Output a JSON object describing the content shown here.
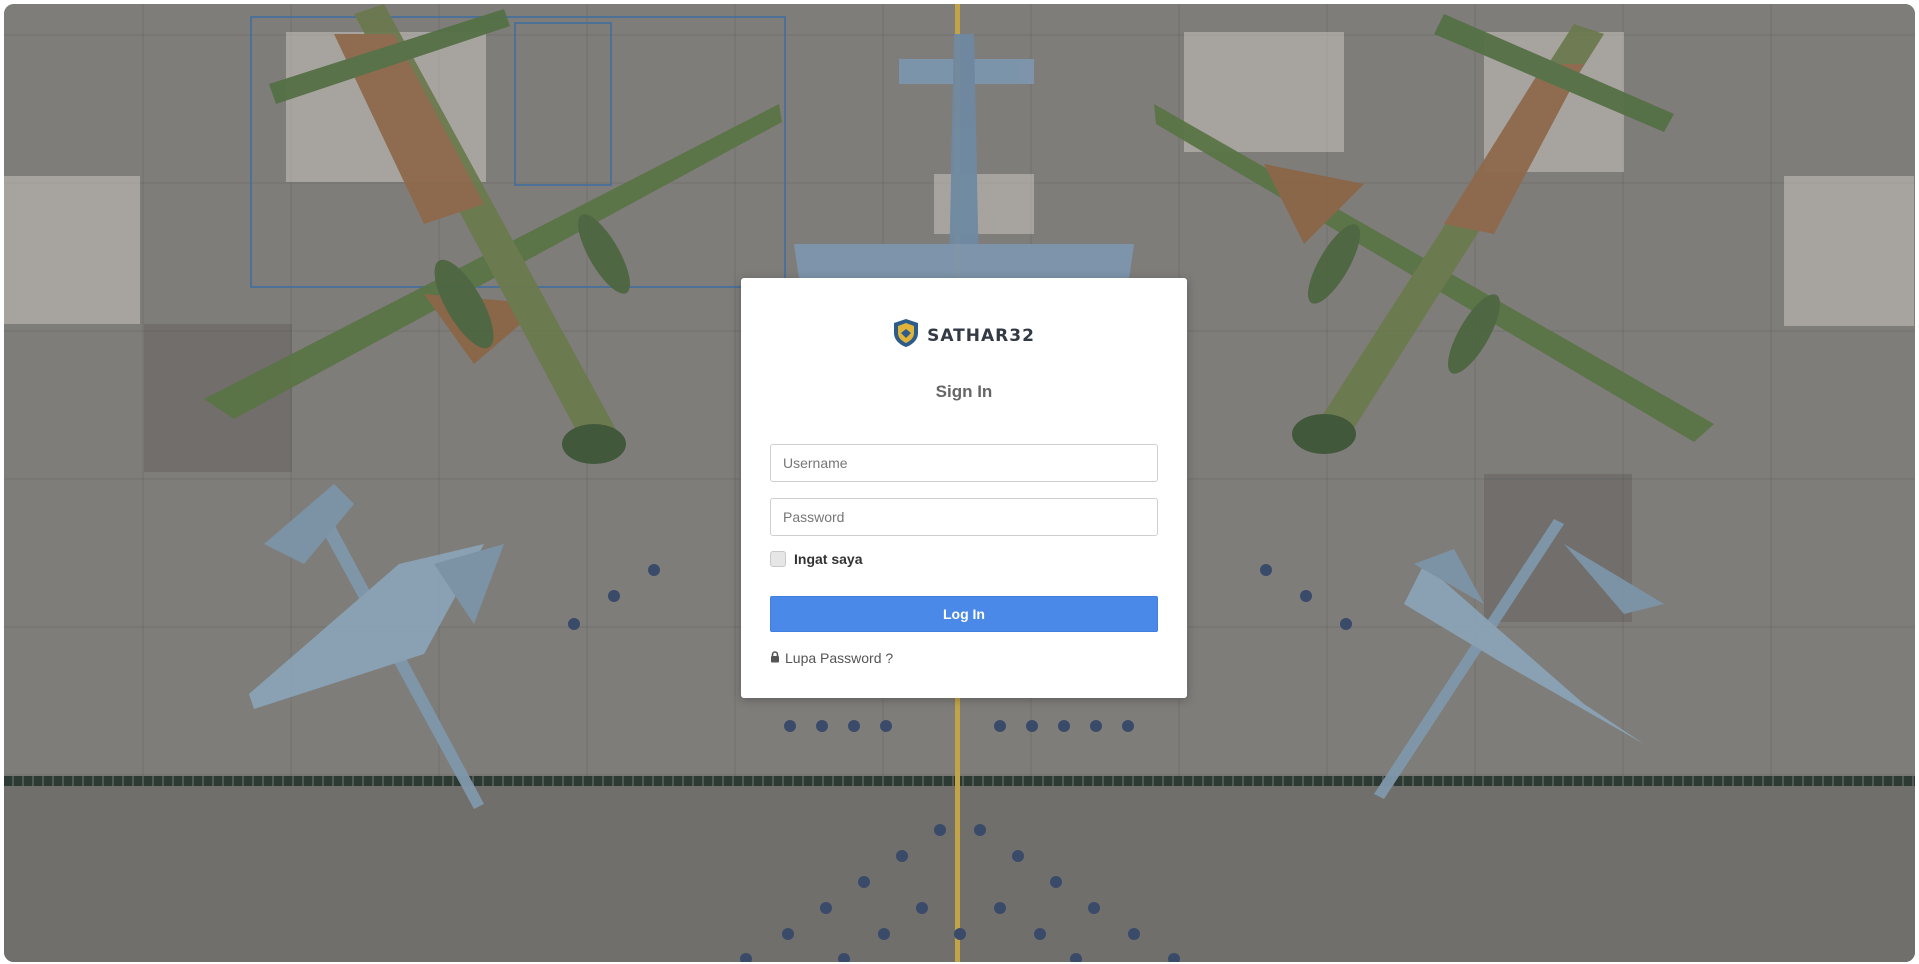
{
  "brand": {
    "name": "SATHAR32",
    "logo_icon": "shield-emblem-icon"
  },
  "login": {
    "title": "Sign In",
    "username_placeholder": "Username",
    "password_placeholder": "Password",
    "remember_label": "Ingat saya",
    "submit_label": "Log In",
    "forgot_label": "Lupa Password ?",
    "forgot_icon": "lock-icon"
  },
  "colors": {
    "primary_button": "#4a89e8",
    "card_background": "#ffffff"
  }
}
